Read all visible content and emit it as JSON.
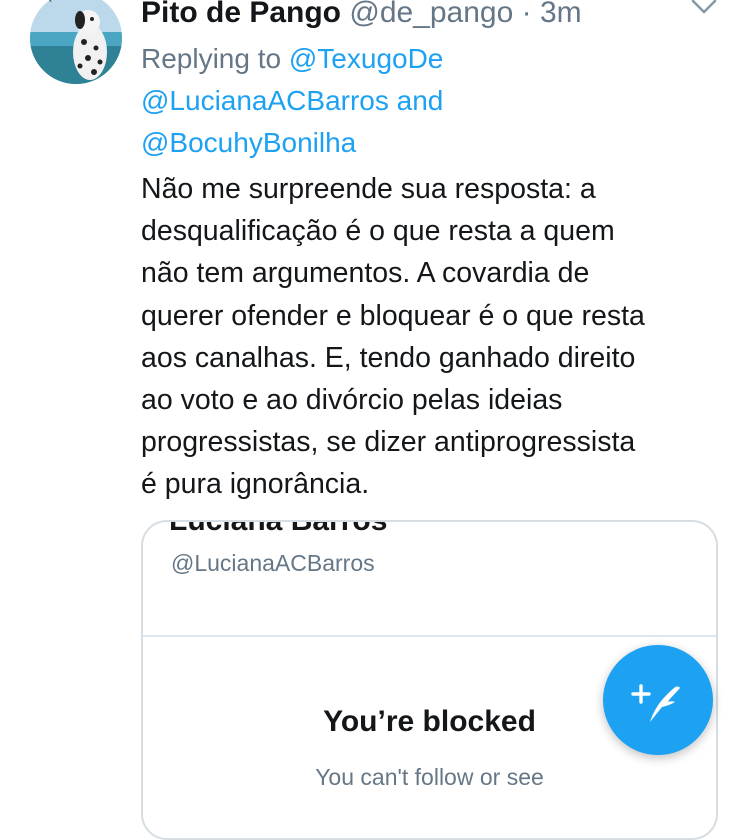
{
  "tweet": {
    "author_name": "Pito de Pango",
    "author_handle": "@de_pango",
    "separator": " · ",
    "time": "3m",
    "replying_to_prefix": "Replying to ",
    "mentions": [
      "@TexugoDe",
      "@LucianaACBarros",
      "@BocuhyBonilha"
    ],
    "conjunction": " and",
    "text_lines": [
      "Não me surpreende sua resposta: a",
      "desqualificação é o que resta a quem",
      "não tem argumentos. A covardia de",
      "querer ofender e bloquear é o que resta",
      "aos canalhas. E, tendo ganhado direito",
      "ao voto e ao divórcio pelas ideias",
      "progressistas, se dizer antiprogressista",
      "é pura ignorância."
    ]
  },
  "embedded_card": {
    "name": "Luciana Barros",
    "handle": "@LucianaACBarros",
    "blocked_title": "You’re blocked",
    "blocked_subtitle": "You can't follow or see"
  },
  "icons": {
    "menu": "chevron-down-icon",
    "compose": "compose-tweet-icon",
    "avatar": "avatar-photo"
  },
  "colors": {
    "accent": "#1da1f2",
    "text": "#14171a",
    "muted": "#657786",
    "border": "#d6dde3"
  }
}
